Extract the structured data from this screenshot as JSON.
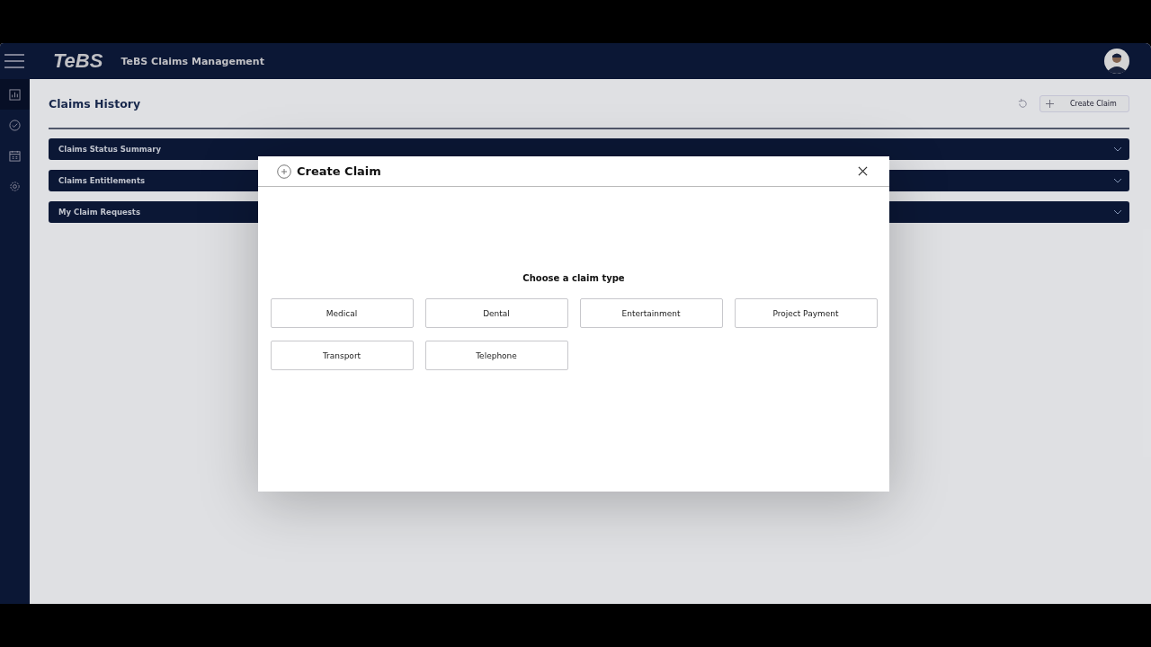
{
  "header": {
    "logo": "TeBS",
    "title": "TeBS Claims Management"
  },
  "sidebar": {
    "items": [
      {
        "kind": "chart",
        "selected": true
      },
      {
        "kind": "check",
        "selected": false
      },
      {
        "kind": "calendar",
        "selected": false
      },
      {
        "kind": "settings",
        "selected": false
      }
    ]
  },
  "page": {
    "title": "Claims History",
    "create_button": "Create Claim"
  },
  "sections": [
    {
      "label": "Claims Status Summary",
      "expanded": false
    },
    {
      "label": "Claims Entitlements",
      "expanded": false
    },
    {
      "label": "My Claim Requests",
      "expanded": false
    }
  ],
  "dialog": {
    "title": "Create Claim",
    "prompt": "Choose a claim type",
    "options": [
      "Medical",
      "Dental",
      "Entertainment",
      "Project Payment",
      "Transport",
      "Telephone"
    ]
  }
}
